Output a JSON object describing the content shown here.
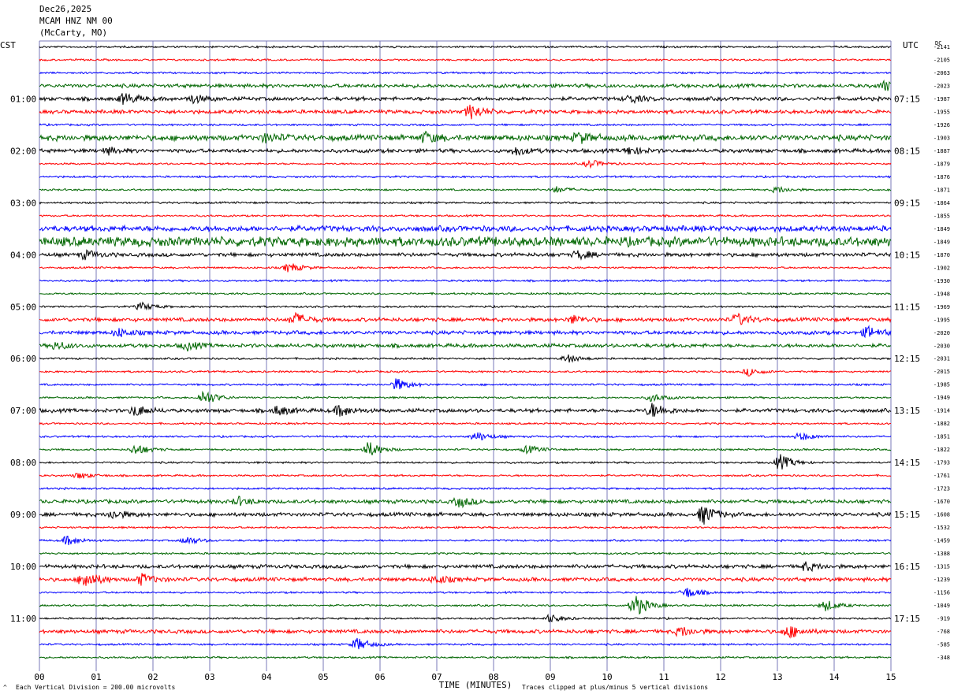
{
  "header": {
    "date": "Dec26,2025",
    "station": "MCAM HNZ NM 00",
    "location": "(McCarty, MO)"
  },
  "left_timezone": "CST",
  "right_timezone": "UTC",
  "dc_header": "DC",
  "footer": {
    "scale_note": "Each Vertical Division =  200.00 microvolts",
    "clip_note": "Traces clipped at plus/minus 5 vertical divisions",
    "corner_mark": "^"
  },
  "chart_data": {
    "type": "line",
    "title": "",
    "xlabel": "TIME (MINUTES)",
    "x_ticks": [
      "00",
      "01",
      "02",
      "03",
      "04",
      "05",
      "06",
      "07",
      "08",
      "09",
      "10",
      "11",
      "12",
      "13",
      "14",
      "15"
    ],
    "xlim": [
      0,
      15
    ],
    "left_hour_labels": [
      "01:00",
      "02:00",
      "03:00",
      "04:00",
      "05:00",
      "06:00",
      "07:00",
      "08:00",
      "09:00",
      "10:00",
      "11:00"
    ],
    "right_hour_labels": [
      "07:15",
      "08:15",
      "09:15",
      "10:15",
      "11:15",
      "12:15",
      "13:15",
      "14:15",
      "15:15",
      "16:15",
      "17:15"
    ],
    "dc_values": [
      "-2141",
      "-2105",
      "-2063",
      "-2023",
      "-1987",
      "-1955",
      "-1926",
      "-1903",
      "-1887",
      "-1879",
      "-1876",
      "-1871",
      "-1864",
      "-1855",
      "-1849",
      "-1849",
      "-1870",
      "-1902",
      "-1930",
      "-1948",
      "-1969",
      "-1995",
      "-2020",
      "-2030",
      "-2031",
      "-2015",
      "-1985",
      "-1949",
      "-1914",
      "-1882",
      "-1851",
      "-1822",
      "-1793",
      "-1761",
      "-1723",
      "-1670",
      "-1608",
      "-1532",
      "-1459",
      "-1388",
      "-1315",
      "-1239",
      "-1156",
      "-1049",
      "-919",
      "-768",
      "-585",
      "-348"
    ],
    "trace_colors": [
      "#000000",
      "#ff0000",
      "#0000ff",
      "#006600"
    ],
    "grid_color": "#7a7ab8",
    "grid": true,
    "trace_count": 48,
    "minutes_per_trace": 15,
    "noise_levels": [
      1,
      1,
      1,
      2,
      2,
      2,
      1,
      3,
      2,
      1,
      1,
      1,
      1,
      1,
      3,
      5,
      2,
      1,
      1,
      1,
      1,
      2,
      2,
      2,
      1,
      1,
      1,
      1,
      2,
      1,
      1,
      1,
      1,
      1,
      1,
      2,
      2,
      1,
      1,
      1,
      2,
      2,
      1,
      1,
      1,
      2,
      1,
      1
    ],
    "events": [
      {
        "trace": 3,
        "minute": 14.9,
        "amplitude": 6
      },
      {
        "trace": 4,
        "minute": 1.5,
        "amplitude": 7
      },
      {
        "trace": 4,
        "minute": 2.7,
        "amplitude": 5
      },
      {
        "trace": 4,
        "minute": 10.4,
        "amplitude": 5
      },
      {
        "trace": 5,
        "minute": 7.6,
        "amplitude": 9
      },
      {
        "trace": 7,
        "minute": 4.0,
        "amplitude": 5
      },
      {
        "trace": 7,
        "minute": 6.8,
        "amplitude": 6
      },
      {
        "trace": 7,
        "minute": 9.5,
        "amplitude": 6
      },
      {
        "trace": 8,
        "minute": 1.2,
        "amplitude": 4
      },
      {
        "trace": 8,
        "minute": 8.4,
        "amplitude": 5
      },
      {
        "trace": 8,
        "minute": 10.4,
        "amplitude": 5
      },
      {
        "trace": 9,
        "minute": 9.7,
        "amplitude": 5
      },
      {
        "trace": 11,
        "minute": 9.1,
        "amplitude": 4
      },
      {
        "trace": 11,
        "minute": 13.0,
        "amplitude": 4
      },
      {
        "trace": 16,
        "minute": 0.8,
        "amplitude": 5
      },
      {
        "trace": 16,
        "minute": 9.5,
        "amplitude": 5
      },
      {
        "trace": 17,
        "minute": 4.4,
        "amplitude": 6
      },
      {
        "trace": 20,
        "minute": 1.8,
        "amplitude": 5
      },
      {
        "trace": 21,
        "minute": 4.5,
        "amplitude": 8
      },
      {
        "trace": 21,
        "minute": 9.4,
        "amplitude": 5
      },
      {
        "trace": 21,
        "minute": 12.3,
        "amplitude": 7
      },
      {
        "trace": 22,
        "minute": 1.4,
        "amplitude": 5
      },
      {
        "trace": 22,
        "minute": 14.6,
        "amplitude": 7
      },
      {
        "trace": 23,
        "minute": 0.3,
        "amplitude": 5
      },
      {
        "trace": 23,
        "minute": 2.6,
        "amplitude": 5
      },
      {
        "trace": 24,
        "minute": 9.3,
        "amplitude": 5
      },
      {
        "trace": 25,
        "minute": 12.5,
        "amplitude": 5
      },
      {
        "trace": 26,
        "minute": 6.3,
        "amplitude": 8
      },
      {
        "trace": 27,
        "minute": 2.9,
        "amplitude": 10
      },
      {
        "trace": 27,
        "minute": 10.8,
        "amplitude": 5
      },
      {
        "trace": 28,
        "minute": 1.7,
        "amplitude": 7
      },
      {
        "trace": 28,
        "minute": 4.2,
        "amplitude": 6
      },
      {
        "trace": 28,
        "minute": 5.3,
        "amplitude": 7
      },
      {
        "trace": 28,
        "minute": 10.8,
        "amplitude": 9
      },
      {
        "trace": 30,
        "minute": 7.7,
        "amplitude": 6
      },
      {
        "trace": 30,
        "minute": 13.4,
        "amplitude": 5
      },
      {
        "trace": 31,
        "minute": 1.7,
        "amplitude": 7
      },
      {
        "trace": 31,
        "minute": 5.8,
        "amplitude": 10
      },
      {
        "trace": 31,
        "minute": 8.6,
        "amplitude": 5
      },
      {
        "trace": 32,
        "minute": 13.05,
        "amplitude": 10
      },
      {
        "trace": 33,
        "minute": 0.7,
        "amplitude": 4
      },
      {
        "trace": 35,
        "minute": 3.5,
        "amplitude": 5
      },
      {
        "trace": 35,
        "minute": 7.4,
        "amplitude": 6
      },
      {
        "trace": 36,
        "minute": 1.3,
        "amplitude": 5
      },
      {
        "trace": 36,
        "minute": 11.7,
        "amplitude": 12
      },
      {
        "trace": 38,
        "minute": 0.5,
        "amplitude": 6
      },
      {
        "trace": 38,
        "minute": 2.6,
        "amplitude": 5
      },
      {
        "trace": 40,
        "minute": 13.5,
        "amplitude": 5
      },
      {
        "trace": 41,
        "minute": 0.8,
        "amplitude": 12
      },
      {
        "trace": 41,
        "minute": 1.8,
        "amplitude": 7
      },
      {
        "trace": 41,
        "minute": 7.0,
        "amplitude": 5
      },
      {
        "trace": 42,
        "minute": 11.4,
        "amplitude": 7
      },
      {
        "trace": 43,
        "minute": 10.5,
        "amplitude": 14
      },
      {
        "trace": 43,
        "minute": 13.85,
        "amplitude": 7
      },
      {
        "trace": 44,
        "minute": 9.0,
        "amplitude": 5
      },
      {
        "trace": 45,
        "minute": 11.3,
        "amplitude": 6
      },
      {
        "trace": 45,
        "minute": 13.2,
        "amplitude": 8
      },
      {
        "trace": 46,
        "minute": 5.6,
        "amplitude": 8
      }
    ]
  }
}
